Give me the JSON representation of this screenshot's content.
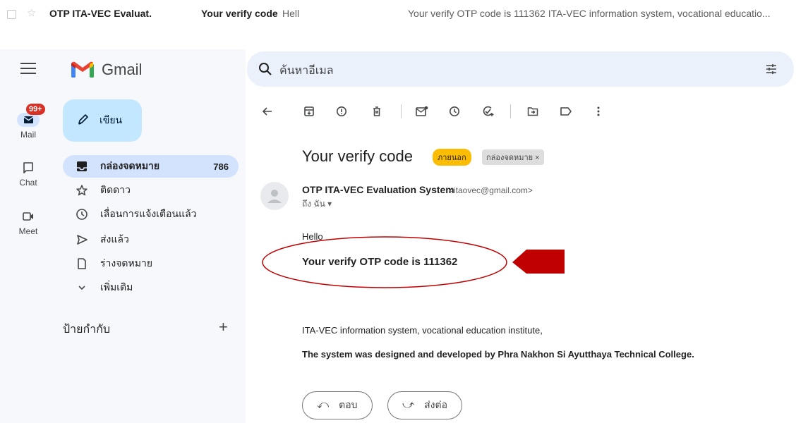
{
  "inbox_preview": {
    "sender": "OTP ITA-VEC Evaluat.",
    "subject": "Your verify code",
    "dash": "-",
    "snippet_start": "Hell",
    "snippet": "Your verify OTP code is 111362 ITA-VEC information system, vocational educatio..."
  },
  "app": {
    "name": "Gmail"
  },
  "search": {
    "placeholder": "ค้นหาอีเมล"
  },
  "rail": {
    "badge": "99+",
    "items": [
      {
        "label": "Mail",
        "icon": "mail-icon"
      },
      {
        "label": "Chat",
        "icon": "chat-icon"
      },
      {
        "label": "Meet",
        "icon": "meet-icon"
      }
    ]
  },
  "compose": {
    "label": "เขียน"
  },
  "nav": {
    "items": [
      {
        "label": "กล่องจดหมาย",
        "count": "786",
        "icon": "inbox-icon",
        "active": true
      },
      {
        "label": "ติดดาว",
        "icon": "star-icon"
      },
      {
        "label": "เลื่อนการแจ้งเตือนแล้ว",
        "icon": "snooze-icon"
      },
      {
        "label": "ส่งแล้ว",
        "icon": "send-icon"
      },
      {
        "label": "ร่างจดหมาย",
        "icon": "draft-icon"
      },
      {
        "label": "เพิ่มเติม",
        "icon": "chevron-down-icon"
      }
    ],
    "labels_heading": "ป้ายกำกับ",
    "labels_add": "+"
  },
  "message": {
    "subject": "Your verify code",
    "chip_external": "ภายนอก",
    "chip_inbox": "กล่องจดหมาย ×",
    "from_name": "OTP ITA-VEC Evaluation System",
    "from_email": "<itaovec@gmail.com>",
    "to_line": "ถึง ฉัน ▾",
    "greeting": "Hello",
    "otp_line": "Your verify OTP code is 111362",
    "signature_1": "ITA-VEC information system, vocational education institute,",
    "signature_2": "The system was designed and developed by Phra Nakhon Si Ayutthaya Technical College."
  },
  "actions": {
    "reply": "ตอบ",
    "forward": "ส่งต่อ"
  },
  "colors": {
    "annotation": "#c00000",
    "chip_external": "#fbbc04",
    "nav_active": "#d3e3fd",
    "compose_bg": "#c2e7ff"
  }
}
